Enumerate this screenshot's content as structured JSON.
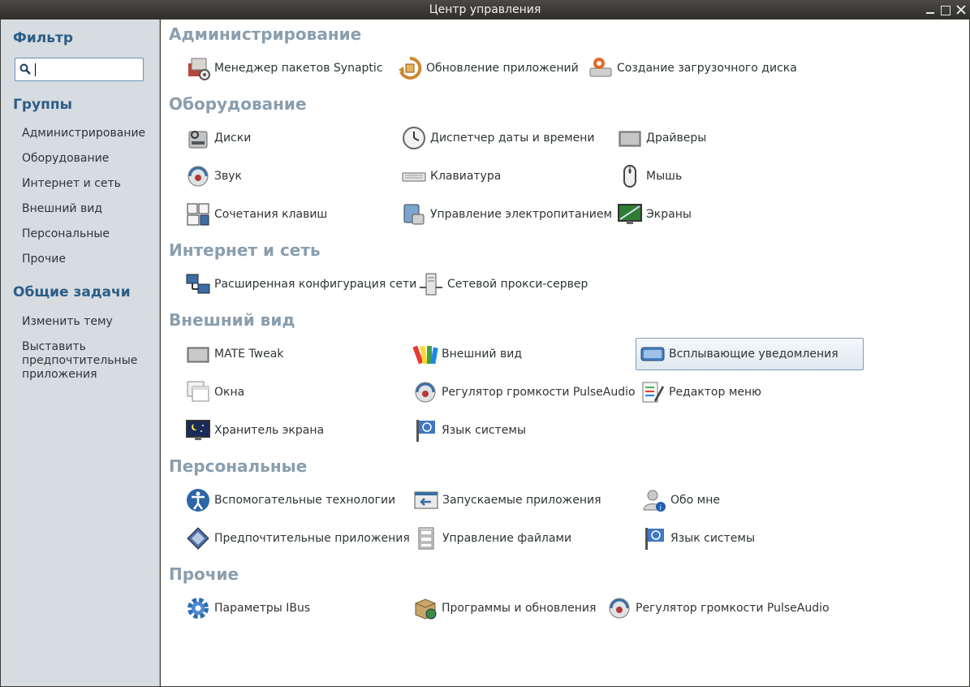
{
  "window": {
    "title": "Центр управления"
  },
  "sidebar": {
    "filter_heading": "Фильтр",
    "search": {
      "value": "",
      "placeholder": ""
    },
    "groups_heading": "Группы",
    "groups": [
      "Администрирование",
      "Оборудование",
      "Интернет и сеть",
      "Внешний вид",
      "Персональные",
      "Прочие"
    ],
    "tasks_heading": "Общие задачи",
    "tasks": [
      "Изменить тему",
      "Выставить предпочтительные приложения"
    ]
  },
  "sections": {
    "admin": {
      "title": "Администрирование",
      "items": [
        {
          "label": "Менеджер пакетов Synaptic",
          "icon": "synaptic-icon"
        },
        {
          "label": "Обновление приложений",
          "icon": "software-update-icon"
        },
        {
          "label": "Создание загрузочного диска",
          "icon": "usb-creator-icon"
        }
      ]
    },
    "hardware": {
      "title": "Оборудование",
      "items": [
        {
          "label": "Диски",
          "icon": "disks-icon"
        },
        {
          "label": "Диспетчер даты и времени",
          "icon": "clock-icon"
        },
        {
          "label": "Драйверы",
          "icon": "drivers-icon"
        },
        {
          "label": "Звук",
          "icon": "sound-icon"
        },
        {
          "label": "Клавиатура",
          "icon": "keyboard-icon"
        },
        {
          "label": "Мышь",
          "icon": "mouse-icon"
        },
        {
          "label": "Сочетания клавиш",
          "icon": "shortcuts-icon"
        },
        {
          "label": "Управление электропитанием",
          "icon": "power-icon"
        },
        {
          "label": "Экраны",
          "icon": "display-icon"
        }
      ]
    },
    "internet": {
      "title": "Интернет и сеть",
      "items": [
        {
          "label": "Расширенная конфигурация сети",
          "icon": "network-icon"
        },
        {
          "label": "Сетевой прокси-сервер",
          "icon": "proxy-icon"
        }
      ]
    },
    "appearance": {
      "title": "Внешний вид",
      "items": [
        {
          "label": "MATE Tweak",
          "icon": "mate-tweak-icon"
        },
        {
          "label": "Внешний вид",
          "icon": "appearance-icon"
        },
        {
          "label": "Всплывающие уведомления",
          "icon": "notification-icon"
        },
        {
          "label": "Окна",
          "icon": "windows-icon"
        },
        {
          "label": "Регулятор громкости PulseAudio",
          "icon": "pulseaudio-icon"
        },
        {
          "label": "Редактор меню",
          "icon": "menu-editor-icon"
        },
        {
          "label": "Хранитель экрана",
          "icon": "screensaver-icon"
        },
        {
          "label": "Язык системы",
          "icon": "language-flag-icon"
        }
      ]
    },
    "personal": {
      "title": "Персональные",
      "items": [
        {
          "label": "Вспомогательные технологии",
          "icon": "accessibility-icon"
        },
        {
          "label": "Запускаемые приложения",
          "icon": "startup-apps-icon"
        },
        {
          "label": "Обо мне",
          "icon": "about-me-icon"
        },
        {
          "label": "Предпочтительные приложения",
          "icon": "preferred-apps-icon"
        },
        {
          "label": "Управление файлами",
          "icon": "file-management-icon"
        },
        {
          "label": "Язык системы",
          "icon": "language-flag-icon"
        }
      ]
    },
    "other": {
      "title": "Прочие",
      "items": [
        {
          "label": "Параметры IBus",
          "icon": "ibus-gear-icon"
        },
        {
          "label": "Программы и обновления",
          "icon": "software-sources-icon"
        },
        {
          "label": "Регулятор громкости PulseAudio",
          "icon": "pulseaudio-icon"
        }
      ]
    }
  },
  "selected_item": "Всплывающие уведомления",
  "colors": {
    "section_title": "#8a9eae",
    "sidebar_heading": "#2b5d86",
    "sidebar_bg": "#d7dce1",
    "selection_border": "#7d9cb8"
  }
}
